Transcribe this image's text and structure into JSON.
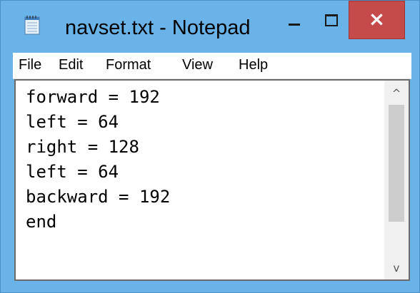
{
  "window": {
    "title": "navset.txt - Notepad",
    "app_icon": "notepad-icon",
    "controls": {
      "minimize": "minimize-icon",
      "maximize": "maximize-icon",
      "close": "×"
    }
  },
  "menu": {
    "items": [
      "File",
      "Edit",
      "Format",
      "View",
      "Help"
    ]
  },
  "editor": {
    "lines": [
      "forward = 192",
      "left = 64",
      "right = 128",
      "left = 64",
      "backward = 192",
      "end"
    ]
  },
  "scrollbar": {
    "up_arrow": "^",
    "down_arrow": "v"
  },
  "colors": {
    "frame": "#6ab3e8",
    "close_button": "#c54b4b"
  }
}
